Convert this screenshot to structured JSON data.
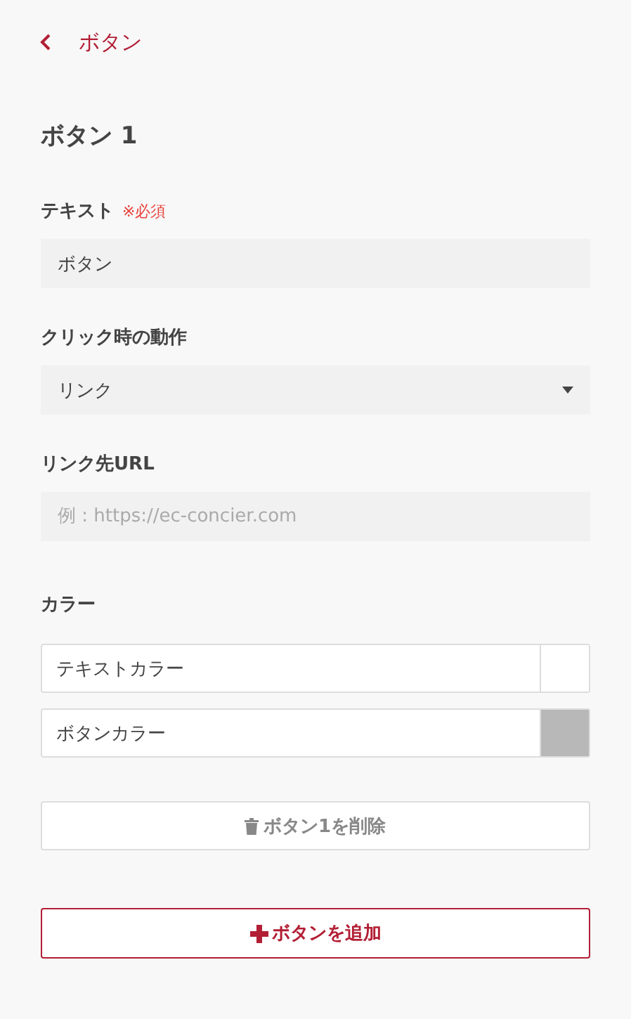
{
  "header": {
    "title": "ボタン"
  },
  "section_title": "ボタン 1",
  "fields": [
    {
      "kind": "text",
      "label": "テキスト",
      "required_mark": "※必須",
      "value": "ボタン"
    },
    {
      "kind": "select",
      "label": "クリック時の動作",
      "value": "リンク"
    },
    {
      "kind": "text",
      "label": "リンク先URL",
      "placeholder": "例 : https://ec-concier.com"
    }
  ],
  "colors": {
    "label": "カラー",
    "items": [
      {
        "label": "テキストカラー",
        "color": "#ffffff"
      },
      {
        "label": "ボタンカラー",
        "color": "#b8b8b8"
      }
    ]
  },
  "delete_button": "ボタン1を削除",
  "add_button": "ボタンを追加"
}
